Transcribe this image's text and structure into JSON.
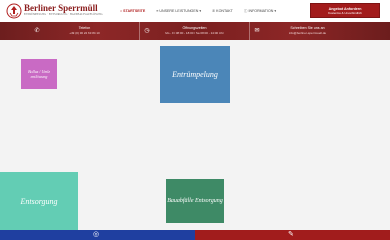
{
  "brand": {
    "name": "Berliner Sperrmüll",
    "tagline": "ENTRÜMPELUNG · ENTSORGUNG · HAUSHALTSAUFLÖSUNG"
  },
  "nav": {
    "items": [
      {
        "label": "STARTSEITE",
        "icon": "home-icon",
        "active": true
      },
      {
        "label": "UNSERE LEISTUNGEN",
        "icon": "list-icon",
        "dropdown": true
      },
      {
        "label": "KONTAKT",
        "icon": "phone-icon"
      },
      {
        "label": "INFORMATION",
        "icon": "info-icon",
        "dropdown": true
      }
    ]
  },
  "cta": {
    "title": "Angebot Anfordern",
    "subtitle": "Kostenlos & Unverbindlich"
  },
  "infobar": {
    "items": [
      {
        "title": "Telefon",
        "value": "+49 (0) 30 22 63 84 10",
        "icon": "phone-icon"
      },
      {
        "title": "Öffnungszeiten",
        "value": "Mo - Fr 08:00 - 18:00 / Sa 08:00 - 14:00 Uhr",
        "icon": "clock-icon"
      },
      {
        "title": "Schreiben Sie uns an",
        "value": "info@berliner-sperrmuell.de",
        "icon": "mail-icon"
      }
    ]
  },
  "hero": {
    "tiles": [
      {
        "label": "Bollus / Umlz entlöwung",
        "color": "#c96ac4"
      },
      {
        "label": "Entrümpelung",
        "color": "#4b86b8"
      },
      {
        "label": "Entsorgung",
        "color": "#63cdb4"
      },
      {
        "label": "Bauabfälle Entsorgung",
        "color": "#3e8a66"
      }
    ]
  },
  "bottom": {
    "left_color": "#1f3fa0",
    "right_color": "#a11c1c",
    "left_icon": "circle-icon",
    "right_icon": "pen-icon"
  },
  "colors": {
    "accent": "#a21c1c",
    "header_bg": "#ffffff",
    "infobar": "#7a2020"
  }
}
